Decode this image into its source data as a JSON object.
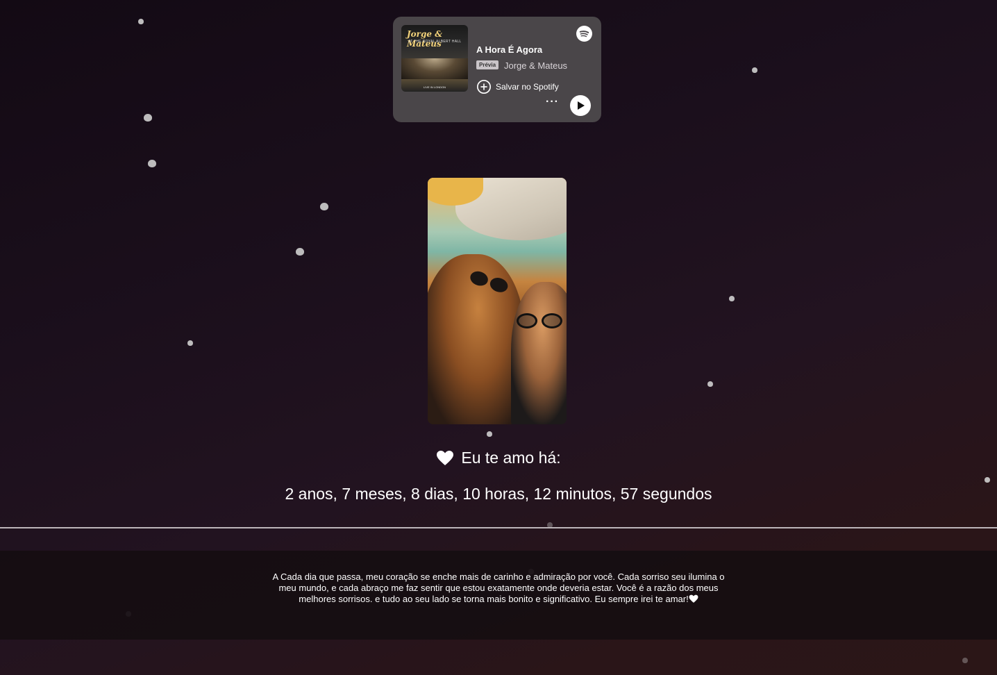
{
  "spotify_card": {
    "track_title": "A Hora É Agora",
    "badge": "Prévia",
    "artist": "Jorge & Mateus",
    "save_label": "Salvar no Spotify",
    "more_label": "···",
    "cover": {
      "title": "Jorge & Mateus",
      "subtitle": "AT THE ROYAL ALBERT HALL",
      "footer": "LIVE IN LONDON"
    }
  },
  "photo": {
    "icon": "couple-photo"
  },
  "love_counter": {
    "title": "Eu te amo há:",
    "elapsed": "2 anos, 7 meses, 8 dias, 10 horas, 12 minutos, 57 segundos"
  },
  "message": {
    "text": "A Cada dia que passa, meu coração se enche mais de carinho e admiração por você. Cada sorriso seu ilumina o meu mundo, e cada abraço me faz sentir que estou exatamente onde deveria estar. Você é a razão dos meus melhores sorrisos. e tudo ao seu lado se torna mais bonito e significativo. Eu sempre irei te amar!"
  },
  "colors": {
    "card_bg": "#4a4649",
    "heart": "#ffffff",
    "divider": "#bdb6ba"
  }
}
